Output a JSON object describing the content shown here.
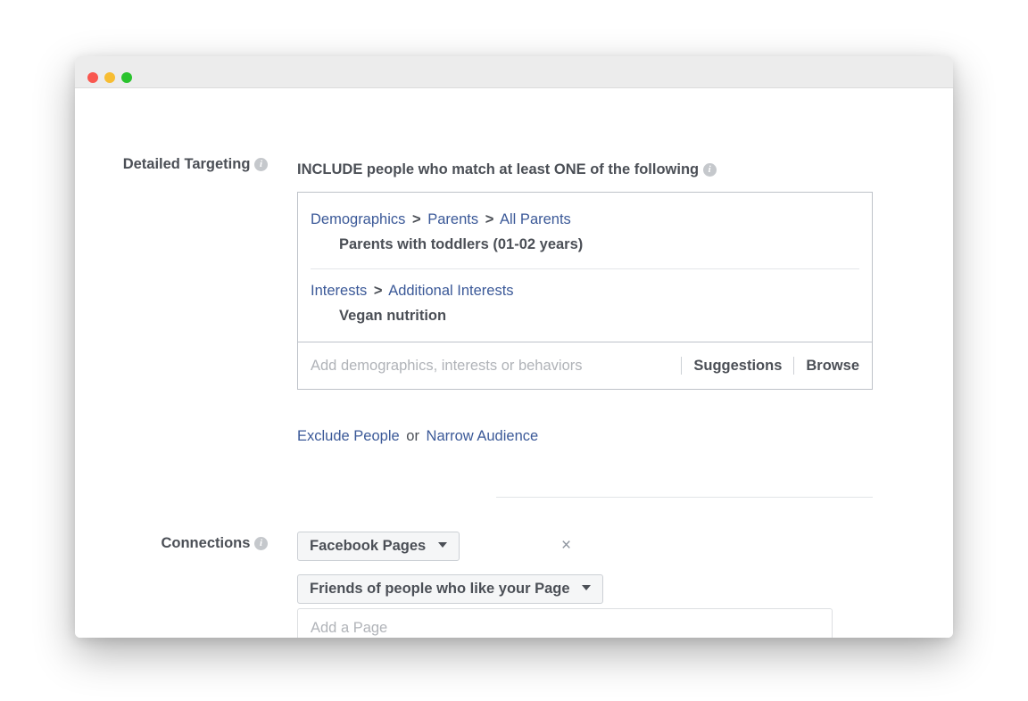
{
  "window": {
    "traffic_lights": [
      {
        "name": "close",
        "color": "#f9574f"
      },
      {
        "name": "minimize",
        "color": "#f7bd33"
      },
      {
        "name": "maximize",
        "color": "#2ac32e"
      }
    ]
  },
  "detailed_targeting": {
    "label": "Detailed Targeting",
    "info_glyph": "i",
    "include_heading": "INCLUDE people who match at least ONE of the following",
    "groups": [
      {
        "breadcrumb": [
          "Demographics",
          "Parents",
          "All Parents"
        ],
        "separator": ">",
        "selection": "Parents with toddlers (01-02 years)"
      },
      {
        "breadcrumb": [
          "Interests",
          "Additional Interests"
        ],
        "separator": ">",
        "selection": "Vegan nutrition"
      }
    ],
    "search_placeholder": "Add demographics, interests or behaviors",
    "search_value": "",
    "suggestions_label": "Suggestions",
    "browse_label": "Browse",
    "exclude_label": "Exclude People",
    "or_label": "or",
    "narrow_label": "Narrow Audience"
  },
  "connections": {
    "label": "Connections",
    "info_glyph": "i",
    "type_dropdown": "Facebook Pages",
    "detail_dropdown": "Friends of people who like your Page",
    "remove_glyph": "×",
    "add_page_placeholder": "Add a Page",
    "add_page_value": ""
  },
  "colors": {
    "link": "#3b5998",
    "text": "#4b4f56",
    "placeholder": "#b0b3b8",
    "box_border": "#bec2c9",
    "titlebar": "#ececec"
  }
}
